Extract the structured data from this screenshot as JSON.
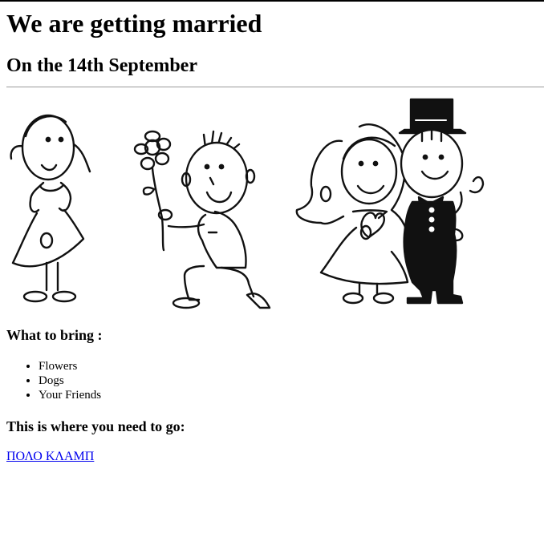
{
  "header": {
    "title": "We are getting married",
    "date": "On the 14th September"
  },
  "illustration": {
    "figures": [
      "girl-figure-icon",
      "kneeling-boy-with-flower-icon",
      "bride-and-groom-icon"
    ]
  },
  "bring": {
    "heading": "What to bring :",
    "items": [
      "Flowers",
      "Dogs",
      "Your Friends"
    ]
  },
  "location": {
    "heading": "This is where you need to go:",
    "link_text": "ΠΟΛΟ ΚΛΑΜΠ"
  },
  "colors": {
    "link": "#0000ee",
    "text": "#000000",
    "rule": "#9a9a9a"
  }
}
